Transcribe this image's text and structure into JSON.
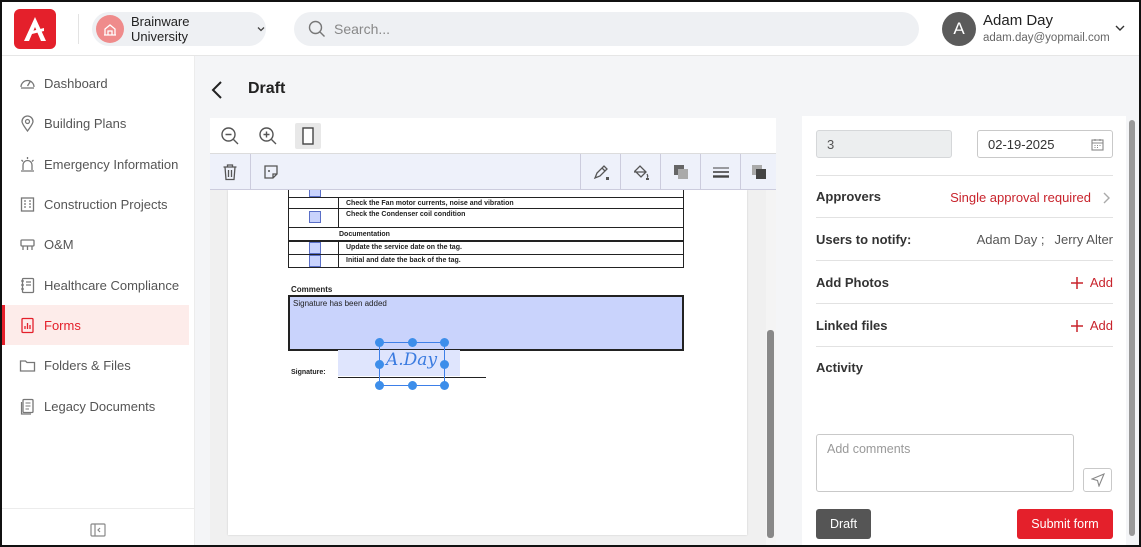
{
  "org": {
    "name": "Brainware University"
  },
  "search": {
    "placeholder": "Search..."
  },
  "user": {
    "initial": "A",
    "name": "Adam Day",
    "email": "adam.day@yopmail.com"
  },
  "sidebar": {
    "items": [
      {
        "label": "Dashboard",
        "icon": "dashboard-icon"
      },
      {
        "label": "Building Plans",
        "icon": "map-pin-icon"
      },
      {
        "label": "Emergency Information",
        "icon": "alarm-icon"
      },
      {
        "label": "Construction Projects",
        "icon": "building-icon"
      },
      {
        "label": "O&M",
        "icon": "tools-icon"
      },
      {
        "label": "Healthcare Compliance",
        "icon": "notebook-icon"
      },
      {
        "label": "Forms",
        "icon": "forms-icon",
        "active": true
      },
      {
        "label": "Folders & Files",
        "icon": "folder-icon"
      },
      {
        "label": "Legacy Documents",
        "icon": "document-icon"
      }
    ]
  },
  "page": {
    "title": "Draft"
  },
  "document": {
    "rows": [
      "Check the Fan motor currents, noise and vibration",
      "Check the Condenser coil condition",
      "Documentation",
      "Update the service date on the tag.",
      "Initial and date the back of the tag."
    ],
    "comments_label": "Comments",
    "comment_text": "Signature has been added",
    "signature_label": "Signature:",
    "signature_value": "A.Day"
  },
  "panel": {
    "number_value": "3",
    "date_value": "02-19-2025",
    "approvers_label": "Approvers",
    "approvers_value": "Single approval required",
    "notify_label": "Users to notify:",
    "notify_users": [
      "Adam Day ;",
      "Jerry Alter"
    ],
    "photos_label": "Add Photos",
    "linked_label": "Linked files",
    "add_label": "Add",
    "activity_label": "Activity",
    "comment_placeholder": "Add comments",
    "draft_button": "Draft",
    "submit_button": "Submit form"
  },
  "colors": {
    "accent": "#e4202b",
    "active_bg": "#fdecea",
    "highlight": "#c9d3fc"
  }
}
